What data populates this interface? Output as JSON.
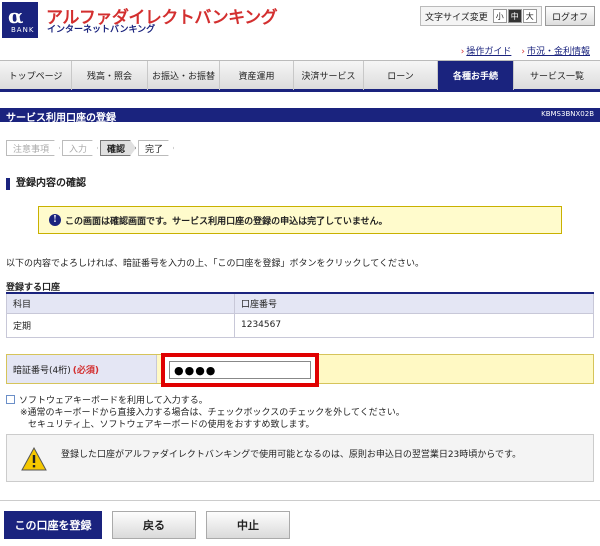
{
  "header": {
    "logo_alpha": "α",
    "logo_bank": "BANK",
    "brand_title": "アルファダイレクトバンキング",
    "brand_sub": "インターネットバンキング",
    "font_size_label": "文字サイズ変更",
    "font_sizes": [
      "小",
      "中",
      "大"
    ],
    "font_size_selected": "中",
    "logoff_label": "ログオフ"
  },
  "sublinks": [
    "操作ガイド",
    "市況・金利情報"
  ],
  "nav": {
    "items": [
      "トップページ",
      "残高・照会",
      "お振込・お振替",
      "資産運用",
      "決済サービス",
      "ローン",
      "各種お手続",
      "サービス一覧"
    ],
    "active": "各種お手続"
  },
  "page": {
    "title": "サービス利用口座の登録",
    "code": "KBMS3BNX02B"
  },
  "steps": [
    "注意事項",
    "入力",
    "確認",
    "完了"
  ],
  "current_step": "確認",
  "section_title": "登録内容の確認",
  "notice": "この画面は確認画面です。サービス利用口座の登録の申込は完了していません。",
  "instruction": "以下の内容でよろしければ、暗証番号を入力の上、「この口座を登録」ボタンをクリックしてください。",
  "account": {
    "title": "登録する口座",
    "headers": [
      "科目",
      "口座番号"
    ],
    "rows": [
      [
        "定期",
        "1234567"
      ]
    ]
  },
  "pin": {
    "label": "暗証番号(4桁)",
    "required": "(必須)",
    "value": "●●●●"
  },
  "keyboard": {
    "label": "ソフトウェアキーボードを利用して入力する。",
    "note1": "※通常のキーボードから直接入力する場合は、チェックボックスのチェックを外してください。",
    "note2": "セキュリティ上、ソフトウェアキーボードの使用をおすすめ致します。"
  },
  "warning": "登録した口座がアルファダイレクトバンキングで使用可能となるのは、原則お申込日の翌営業日23時頃からです。",
  "buttons": {
    "register": "この口座を登録",
    "back": "戻る",
    "cancel": "中止"
  },
  "colors": {
    "brand_navy": "#1a237e",
    "brand_red": "#d32f2f",
    "notice_bg": "#fffbcc",
    "highlight_red": "#e00000"
  }
}
